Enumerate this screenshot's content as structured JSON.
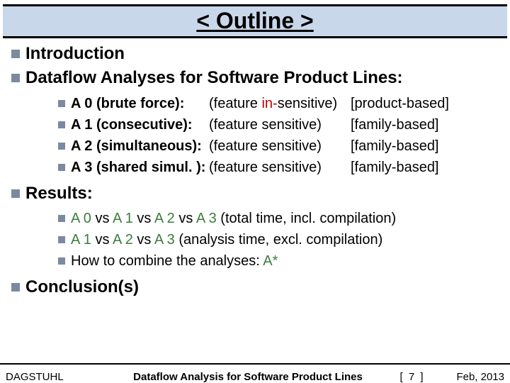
{
  "title": "< Outline >",
  "bullets": {
    "intro": "Introduction",
    "dataflow": "Dataflow Analyses for Software Product Lines:",
    "results": "Results:",
    "conclusion": "Conclusion(s)"
  },
  "algorithms": [
    {
      "name": "A 0 (brute force):",
      "feat_pre": "(feature ",
      "feat_mid": "in-",
      "feat_post": "sensitive)",
      "basis": "[product-based]"
    },
    {
      "name": "A 1 (consecutive):",
      "feat_pre": "(feature sensitive)",
      "feat_mid": "",
      "feat_post": "",
      "basis": "[family-based]"
    },
    {
      "name": "A 2 (simultaneous):",
      "feat_pre": "(feature sensitive)",
      "feat_mid": "",
      "feat_post": "",
      "basis": "[family-based]"
    },
    {
      "name": "A 3 (shared simul. ):",
      "feat_pre": "(feature sensitive)",
      "feat_mid": "",
      "feat_post": "",
      "basis": "[family-based]"
    }
  ],
  "results_items": {
    "r1_a": "A 0 ",
    "r1_b": "vs ",
    "r1_c": "A 1 ",
    "r1_d": "vs ",
    "r1_e": "A 2 ",
    "r1_f": "vs ",
    "r1_g": "A 3 ",
    "r1_tail": "(total time, incl. compilation)",
    "r2_a": "A 1 ",
    "r2_b": "vs ",
    "r2_c": "A 2 ",
    "r2_d": "vs ",
    "r2_e": "A 3 ",
    "r2_tail": "(analysis time, excl. compilation)",
    "r3_pre": "How to combine the analyses: ",
    "r3_astar": "A*"
  },
  "footer": {
    "left": "DAGSTUHL",
    "center": "Dataflow Analysis for Software Product Lines",
    "page": "[ 7 ]",
    "right": "Feb, 2013"
  }
}
